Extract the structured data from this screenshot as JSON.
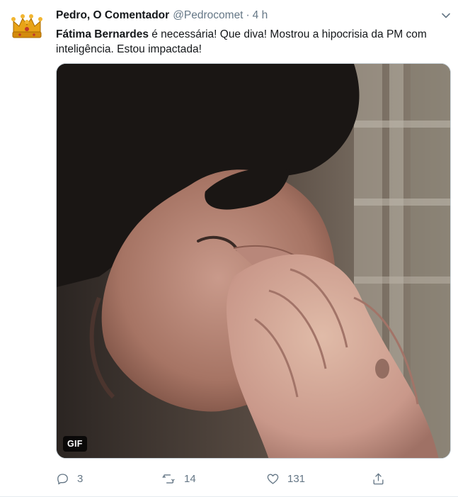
{
  "tweet": {
    "author_name": "Pedro, O Comentador",
    "author_handle": "@Pedrocomet",
    "separator": "·",
    "time": "4 h",
    "text_bold": "Fátima Bernardes",
    "text_rest": " é necessária! Que diva! Mostrou a hipocrisia da PM com inteligência. Estou impactada!",
    "media": {
      "badge": "GIF"
    },
    "actions": {
      "reply_count": "3",
      "retweet_count": "14",
      "like_count": "131"
    }
  },
  "icons": {
    "avatar": "crown-avatar",
    "caret": "chevron-down-icon",
    "reply": "reply-icon",
    "retweet": "retweet-icon",
    "like": "heart-icon",
    "share": "share-icon"
  },
  "colors": {
    "text": "#14171a",
    "secondary": "#657786",
    "border": "#e6ecf0",
    "crown_gold": "#e8a317"
  }
}
